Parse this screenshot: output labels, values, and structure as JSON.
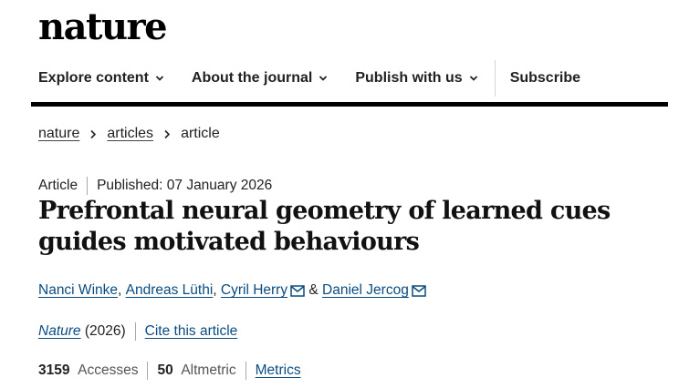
{
  "site": {
    "logo": "nature"
  },
  "nav": {
    "items": [
      {
        "label": "Explore content"
      },
      {
        "label": "About the journal"
      },
      {
        "label": "Publish with us"
      }
    ],
    "subscribe": "Subscribe"
  },
  "breadcrumb": {
    "items": [
      "nature",
      "articles"
    ],
    "current": "article"
  },
  "article": {
    "type": "Article",
    "published": "Published: 07 January 2026",
    "title": "Prefrontal neural geometry of learned cues guides motivated behaviours",
    "authors": [
      "Nanci Winke",
      "Andreas Lüthi",
      "Cyril Herry",
      "Daniel Jercog"
    ],
    "journal": "Nature",
    "year": "(2026)",
    "cite_label": "Cite this article"
  },
  "metrics": {
    "accesses_value": "3159",
    "accesses_label": "Accesses",
    "altmetric_value": "50",
    "altmetric_label": "Altmetric",
    "metrics_link": "Metrics"
  },
  "colors": {
    "link": "#0a4c82",
    "rule": "#000000",
    "text": "#222222"
  }
}
